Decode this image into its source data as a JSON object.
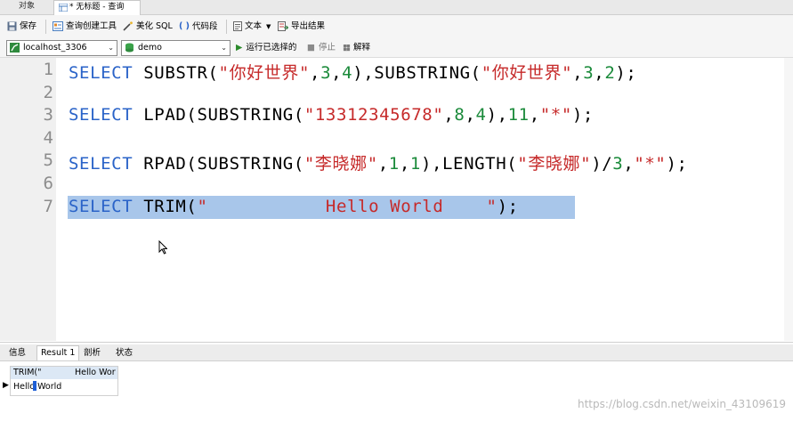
{
  "tabs": {
    "objects": "对象",
    "query": "* 无标题 - 查询"
  },
  "toolbar": {
    "save": "保存",
    "query_builder": "查询创建工具",
    "beautify": "美化 SQL",
    "snippet": "代码段",
    "text": "文本",
    "export": "导出结果"
  },
  "connection": {
    "host": "localhost_3306",
    "database": "demo"
  },
  "actions": {
    "run_selected": "运行已选择的",
    "stop": "停止",
    "explain": "解释"
  },
  "editor": {
    "line_numbers": [
      "1",
      "2",
      "3",
      "4",
      "5",
      "6",
      "7"
    ],
    "lines": [
      [
        {
          "t": "SELECT",
          "c": "kw"
        },
        {
          "t": " SUBSTR(",
          "c": "fn"
        },
        {
          "t": "\"你好世界\"",
          "c": "str"
        },
        {
          "t": ",",
          "c": "pn"
        },
        {
          "t": "3",
          "c": "num"
        },
        {
          "t": ",",
          "c": "pn"
        },
        {
          "t": "4",
          "c": "num"
        },
        {
          "t": "),SUBSTRING(",
          "c": "fn"
        },
        {
          "t": "\"你好世界\"",
          "c": "str"
        },
        {
          "t": ",",
          "c": "pn"
        },
        {
          "t": "3",
          "c": "num"
        },
        {
          "t": ",",
          "c": "pn"
        },
        {
          "t": "2",
          "c": "num"
        },
        {
          "t": ");",
          "c": "pn"
        }
      ],
      [],
      [
        {
          "t": "SELECT",
          "c": "kw"
        },
        {
          "t": " LPAD(SUBSTRING(",
          "c": "fn"
        },
        {
          "t": "\"13312345678\"",
          "c": "str"
        },
        {
          "t": ",",
          "c": "pn"
        },
        {
          "t": "8",
          "c": "num"
        },
        {
          "t": ",",
          "c": "pn"
        },
        {
          "t": "4",
          "c": "num"
        },
        {
          "t": "),",
          "c": "pn"
        },
        {
          "t": "11",
          "c": "num"
        },
        {
          "t": ",",
          "c": "pn"
        },
        {
          "t": "\"*\"",
          "c": "str"
        },
        {
          "t": ");",
          "c": "pn"
        }
      ],
      [],
      [
        {
          "t": "SELECT",
          "c": "kw"
        },
        {
          "t": " RPAD(SUBSTRING(",
          "c": "fn"
        },
        {
          "t": "\"李晓娜\"",
          "c": "str"
        },
        {
          "t": ",",
          "c": "pn"
        },
        {
          "t": "1",
          "c": "num"
        },
        {
          "t": ",",
          "c": "pn"
        },
        {
          "t": "1",
          "c": "num"
        },
        {
          "t": "),LENGTH(",
          "c": "fn"
        },
        {
          "t": "\"李晓娜\"",
          "c": "str"
        },
        {
          "t": ")/",
          "c": "pn"
        },
        {
          "t": "3",
          "c": "num"
        },
        {
          "t": ",",
          "c": "pn"
        },
        {
          "t": "\"*\"",
          "c": "str"
        },
        {
          "t": ");",
          "c": "pn"
        }
      ],
      [],
      [
        {
          "t": "SELECT",
          "c": "kw"
        },
        {
          "t": " TRIM(",
          "c": "fn"
        },
        {
          "t": "\"           Hello World    \"",
          "c": "str"
        },
        {
          "t": ");",
          "c": "pn"
        }
      ]
    ]
  },
  "result_tabs": [
    "信息",
    "Result 1",
    "剖析",
    "状态"
  ],
  "result_grid": {
    "header_left": "TRIM(\"",
    "header_right": "Hello Wor",
    "cell": "Hello World"
  },
  "watermark": "https://blog.csdn.net/weixin_43109619"
}
